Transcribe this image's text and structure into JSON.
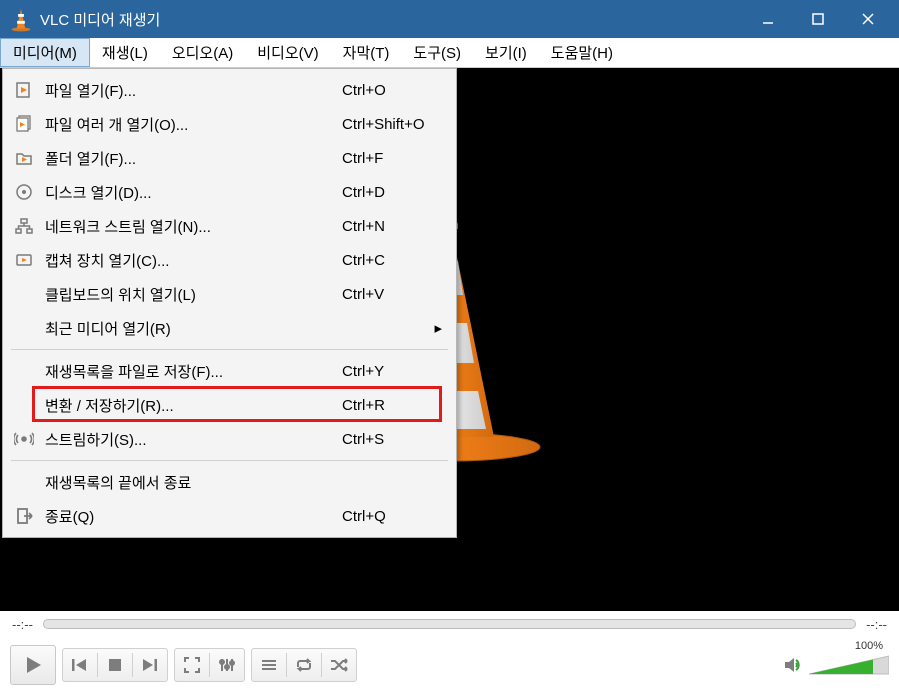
{
  "title": "VLC 미디어 재생기",
  "menubar": {
    "items": [
      "미디어(M)",
      "재생(L)",
      "오디오(A)",
      "비디오(V)",
      "자막(T)",
      "도구(S)",
      "보기(I)",
      "도움말(H)"
    ],
    "active_index": 0
  },
  "dropdown": {
    "items": [
      {
        "icon": "file-play",
        "label": "파일 열기(F)...",
        "shortcut": "Ctrl+O"
      },
      {
        "icon": "file-multi",
        "label": "파일 여러 개 열기(O)...",
        "shortcut": "Ctrl+Shift+O"
      },
      {
        "icon": "folder",
        "label": "폴더 열기(F)...",
        "shortcut": "Ctrl+F"
      },
      {
        "icon": "disc",
        "label": "디스크 열기(D)...",
        "shortcut": "Ctrl+D"
      },
      {
        "icon": "network",
        "label": "네트워크 스트림 열기(N)...",
        "shortcut": "Ctrl+N"
      },
      {
        "icon": "capture",
        "label": "캡쳐 장치 열기(C)...",
        "shortcut": "Ctrl+C"
      },
      {
        "icon": "",
        "label": "클립보드의 위치 열기(L)",
        "shortcut": "Ctrl+V"
      },
      {
        "icon": "",
        "label": "최근 미디어 열기(R)",
        "shortcut": "",
        "submenu": true
      },
      {
        "sep": true
      },
      {
        "icon": "",
        "label": "재생목록을 파일로 저장(F)...",
        "shortcut": "Ctrl+Y"
      },
      {
        "icon": "",
        "label": "변환 / 저장하기(R)...",
        "shortcut": "Ctrl+R",
        "highlight": true
      },
      {
        "icon": "stream",
        "label": "스트림하기(S)...",
        "shortcut": "Ctrl+S"
      },
      {
        "sep": true
      },
      {
        "icon": "",
        "label": "재생목록의 끝에서 종료",
        "shortcut": ""
      },
      {
        "icon": "exit",
        "label": "종료(Q)",
        "shortcut": "Ctrl+Q"
      }
    ]
  },
  "seek": {
    "left_time": "--:--",
    "right_time": "--:--"
  },
  "volume": {
    "percent_label": "100%",
    "value": 100
  }
}
